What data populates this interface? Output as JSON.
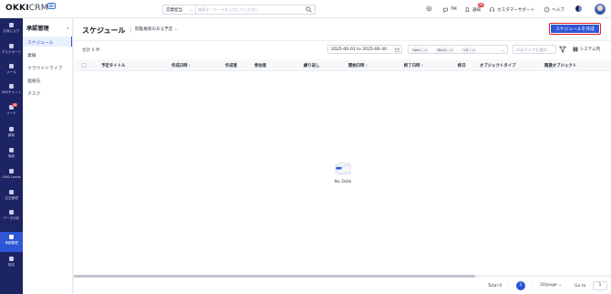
{
  "app": {
    "logo_main": "OKKI",
    "logo_sub": "CRM",
    "logo_badge": "AI"
  },
  "topbar": {
    "search_scope": "営業担当",
    "search_placeholder": "検索キーワードを入力してください",
    "tm_label": "TM",
    "notify_label": "通知",
    "notify_count": "98",
    "support_label": "カスタマーサポート",
    "help_label": "ヘルプ"
  },
  "rail": {
    "items": [
      {
        "label": "お気に入り",
        "icon": "star-icon"
      },
      {
        "label": "デスクボード",
        "icon": "dashboard-icon"
      },
      {
        "label": "メール",
        "icon": "mail-icon"
      },
      {
        "label": "SNSチャット",
        "icon": "chat-icon"
      },
      {
        "label": "リード",
        "icon": "lead-icon",
        "badge": "16"
      },
      {
        "label": "顧客",
        "icon": "customer-icon"
      },
      {
        "label": "商談",
        "icon": "deal-icon"
      },
      {
        "label": "OKKI Leads",
        "icon": "leads-icon"
      },
      {
        "label": "注文管理",
        "icon": "order-icon"
      },
      {
        "label": "データ分析",
        "icon": "analytics-icon"
      },
      {
        "label": "承認管理",
        "icon": "approval-icon",
        "active": true
      },
      {
        "label": "設定",
        "icon": "settings-icon"
      }
    ]
  },
  "subnav": {
    "title": "承認管理",
    "items": [
      {
        "label": "スケジュール",
        "active": true
      },
      {
        "label": "業績"
      },
      {
        "label": "クラウドドライブ"
      },
      {
        "label": "連絡先"
      },
      {
        "label": "タスク"
      }
    ]
  },
  "main": {
    "title": "スケジュール",
    "scope": "閲覧権限のある予定",
    "create_button": "スケジュールを作成",
    "total": "合計 0 件",
    "date_range": "2025-06-01 to 2025-06-30",
    "tags": [
      "hele...",
      "Ryuji...",
      "+4..."
    ],
    "type_placeholder": "計画タイプを選択...",
    "system_columns": "システム列",
    "columns": [
      {
        "label": "予定タイトル",
        "sort": false
      },
      {
        "label": "作成日時",
        "sort": true
      },
      {
        "label": "作成者",
        "sort": false
      },
      {
        "label": "参加者",
        "sort": false
      },
      {
        "label": "繰り返し",
        "sort": false
      },
      {
        "label": "開始日時",
        "sort": true
      },
      {
        "label": "終了日時",
        "sort": true
      },
      {
        "label": "終日",
        "sort": false
      },
      {
        "label": "オブジェクトタイプ",
        "sort": false
      },
      {
        "label": "関連オブジェクト",
        "sort": false
      }
    ],
    "empty_text": "No Data"
  },
  "pagination": {
    "total_label": "Total 0",
    "current_page": "1",
    "page_size": "20/page",
    "goto_label": "Go to",
    "goto_value": "1"
  }
}
